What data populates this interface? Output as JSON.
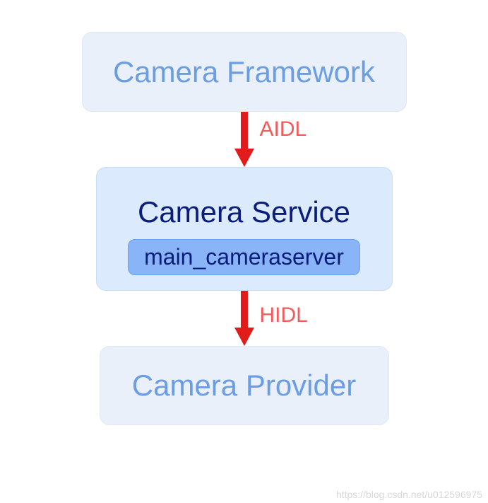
{
  "boxes": {
    "framework": "Camera Framework",
    "service": "Camera Service",
    "service_sub": "main_cameraserver",
    "provider": "Camera Provider"
  },
  "arrows": {
    "aidl_label": "AIDL",
    "hidl_label": "HIDL"
  },
  "colors": {
    "box_light_bg": "#e9f0fa",
    "box_light_text": "#6b9de3",
    "box_service_bg": "#dbeafc",
    "box_service_text": "#0a1d7a",
    "sub_box_bg": "#8ab4f8",
    "arrow_color": "#e21b1b",
    "label_color": "#f15b5b"
  },
  "watermark": "https://blog.csdn.net/u012596975"
}
